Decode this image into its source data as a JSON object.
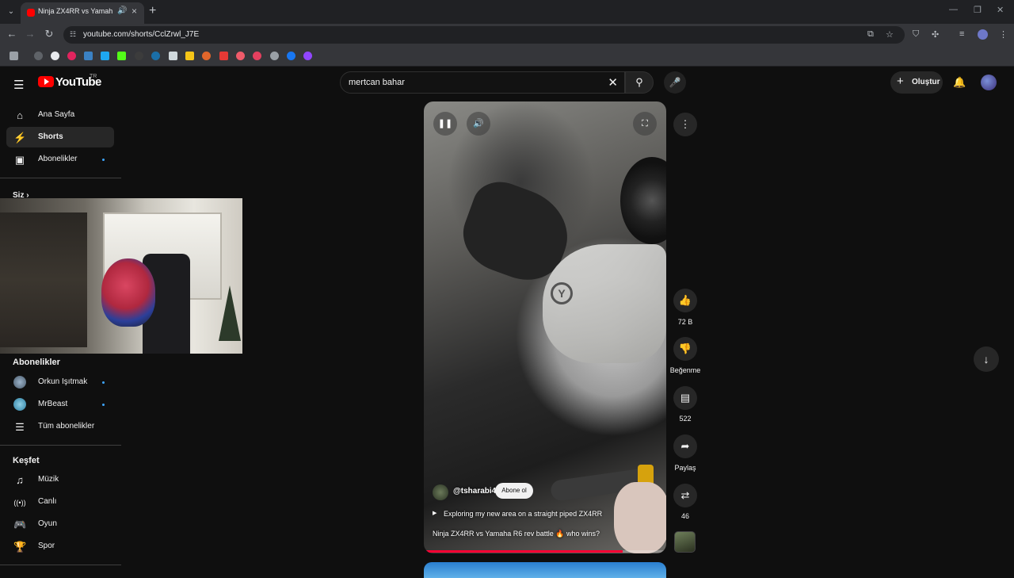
{
  "browser": {
    "tab_title": "Ninja ZX4RR vs Yamaha R6",
    "url": "youtube.com/shorts/CclZrwl_J7E"
  },
  "youtube": {
    "logo_text": "YouTube",
    "country_code": "TR",
    "search_query": "mertcan bahar",
    "create_label": "Oluştur"
  },
  "sidebar": {
    "main_items": [
      {
        "label": "Ana Sayfa"
      },
      {
        "label": "Shorts"
      },
      {
        "label": "Abonelikler"
      }
    ],
    "you_heading": "Siz",
    "subs_heading": "Abonelikler",
    "subs_items": [
      {
        "label": "Orkun Işıtmak"
      },
      {
        "label": "MrBeast"
      },
      {
        "label": "Tüm abonelikler"
      }
    ],
    "explore_heading": "Keşfet",
    "explore_items": [
      {
        "label": "Müzik"
      },
      {
        "label": "Canlı"
      },
      {
        "label": "Oyun"
      },
      {
        "label": "Spor"
      }
    ]
  },
  "short": {
    "channel": "@tsharabi4",
    "subscribe_label": "Abone ol",
    "description": "Exploring my new area on a straight piped ZX4RR",
    "title": "Ninja ZX4RR vs Yamaha R6 rev battle 🔥 who wins?",
    "progress_fraction": 0.82
  },
  "actions": {
    "likes": "72 B",
    "dislike_label": "Beğenme",
    "comments": "522",
    "share_label": "Paylaş",
    "remix_count": "46"
  }
}
